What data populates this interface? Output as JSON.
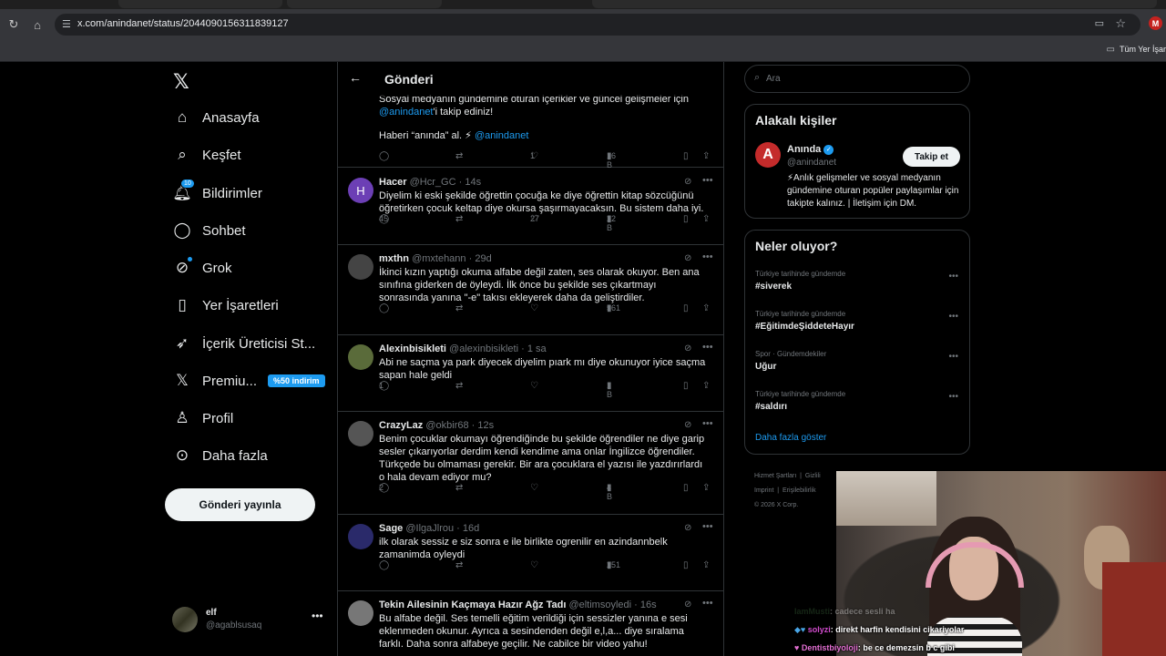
{
  "browser": {
    "url": "x.com/anindanet/status/2044090156311839127",
    "bookmarks_label": "Tüm Yer İşar",
    "profile_initial": "M"
  },
  "nav": {
    "items": [
      {
        "label": "Anasayfa",
        "icon": "home-icon"
      },
      {
        "label": "Keşfet",
        "icon": "search-icon"
      },
      {
        "label": "Bildirimler",
        "icon": "bell-icon",
        "badge": "10"
      },
      {
        "label": "Sohbet",
        "icon": "chat-bubble-icon"
      },
      {
        "label": "Grok",
        "icon": "grok-icon"
      },
      {
        "label": "Yer İşaretleri",
        "icon": "bookmark-icon"
      },
      {
        "label": "İçerik Üreticisi St...",
        "icon": "rocket-icon"
      },
      {
        "label": "Premiu...",
        "icon": "x-logo-icon",
        "promo": "%50 indirim"
      },
      {
        "label": "Profil",
        "icon": "person-icon"
      },
      {
        "label": "Daha fazla",
        "icon": "more-circle-icon"
      }
    ],
    "post_button": "Gönderi yayınla",
    "account": {
      "name": "elf",
      "handle": "@agablsusaq"
    }
  },
  "main": {
    "title": "Gönderi",
    "first_tweet": {
      "line1": "Sosyal medyanın gündemine oturan içerikler ve güncel gelişmeler için",
      "mention": "@anindanet",
      "line2_rest": "'i takip ediniz!",
      "line3": "Haberi “anında” al. ⚡",
      "line3_mention": "@anindanet",
      "replies": "",
      "retweets": "",
      "likes": "1",
      "views": "16 B"
    },
    "tweets": [
      {
        "name": "Hacer",
        "handle": "@Hcr_GC",
        "time": "14s",
        "avatar": "H",
        "text": "Diyelim ki eski şekilde öğrettin çocuğa ke diye öğrettin kitap sözcüğünü öğretirken çocuk keltap diye okursa şaşırmayacaksın. Bu sistem daha iyi.",
        "replies": "45",
        "retweets": "",
        "likes": "27",
        "views": "22 B"
      },
      {
        "name": "mxthn",
        "handle": "@mxtehann",
        "time": "29d",
        "avatar": "",
        "text": "İkinci kızın yaptığı okuma alfabe değil zaten, ses olarak okuyor. Ben ana sınıfına giderken de öyleydi. İlk önce bu şekilde ses çıkartmayı sonrasında yanına \"-e\" takısı ekleyerek daha da geliştirdiler.",
        "replies": "",
        "retweets": "",
        "likes": "",
        "views": "561"
      },
      {
        "name": "Alexinbisikleti",
        "handle": "@alexinbisikleti",
        "time": "1 sa",
        "avatar": "",
        "text": "Abi ne saçma ya park diyecek diyelim pıark mı diye okunuyor iyice saçma sapan hale geldi",
        "replies": "1",
        "retweets": "",
        "likes": "",
        "views": "1 B"
      },
      {
        "name": "CrazyLaz",
        "handle": "@okbir68",
        "time": "12s",
        "avatar": "",
        "text": "Benim çocuklar okumayı öğrendiğinde bu şekilde öğrendiler ne diye garip sesler çıkarıyorlar derdim kendi kendime ama onlar İngilizce öğrendiler. Türkçede bu olmaması gerekir. Bir ara çocuklara el yazısı ile yazdırırlardı o hala devam ediyor mu?",
        "replies": "2",
        "retweets": "",
        "likes": "",
        "views": "4 B"
      },
      {
        "name": "Sage",
        "handle": "@IlgaJlrou",
        "time": "16d",
        "avatar": "",
        "text": "ilk olarak sessiz e siz sonra e ile birlikte ogrenilir en azindannbelk zamanimda oyleydi",
        "replies": "",
        "retweets": "",
        "likes": "",
        "views": "251"
      },
      {
        "name": "Tekin Ailesinin Kaçmaya Hazır Ağz Tadı",
        "handle": "@eltimsoyledi",
        "time": "16s",
        "avatar": "",
        "text": "Bu alfabe değil. Ses temelli eğitim verildiği için sessizler yanına e sesi eklenmeden okunur. Ayrıca a sesindenden değil e,l,a... diye sıralama farklı. Daha sonra alfabeye geçilir. Ne cabilce bir video yahu!",
        "replies": "",
        "retweets": "",
        "likes": "",
        "views": ""
      }
    ]
  },
  "right": {
    "search_placeholder": "Ara",
    "related": {
      "title": "Alakalı kişiler",
      "name": "Anında",
      "handle": "@anindanet",
      "follow": "Takip et",
      "bio": "⚡Anlık gelişmeler ve sosyal medyanın gündemine oturan popüler paylaşımlar için takipte kalınız. | İletişim için DM."
    },
    "trends": {
      "title": "Neler oluyor?",
      "items": [
        {
          "category": "Türkiye tarihinde gündemde",
          "topic": "#siverek"
        },
        {
          "category": "Türkiye tarihinde gündemde",
          "topic": "#EğitimdeŞiddeteHayır"
        },
        {
          "category": "Spor · Gündemdekiler",
          "topic": "Uğur"
        },
        {
          "category": "Türkiye tarihinde gündemde",
          "topic": "#saldırı"
        }
      ],
      "show_more": "Daha fazla göster"
    },
    "footer": {
      "line1a": "Hizmet Şartları",
      "line1b": "Gizlili",
      "line2a": "Imprint",
      "line2b": "Erişilebilirlik",
      "line3": "© 2026 X Corp."
    }
  },
  "chat": [
    {
      "user": "IamMusti",
      "message": ": cadece sesli ha",
      "faded": true
    },
    {
      "user": "solyzi",
      "message": ": direkt harfin kendisini cikariyolar",
      "faded": false
    },
    {
      "user": "Dentistbiyoloji",
      "message": ": be ce demezsin b c gibi",
      "faded": false
    }
  ]
}
